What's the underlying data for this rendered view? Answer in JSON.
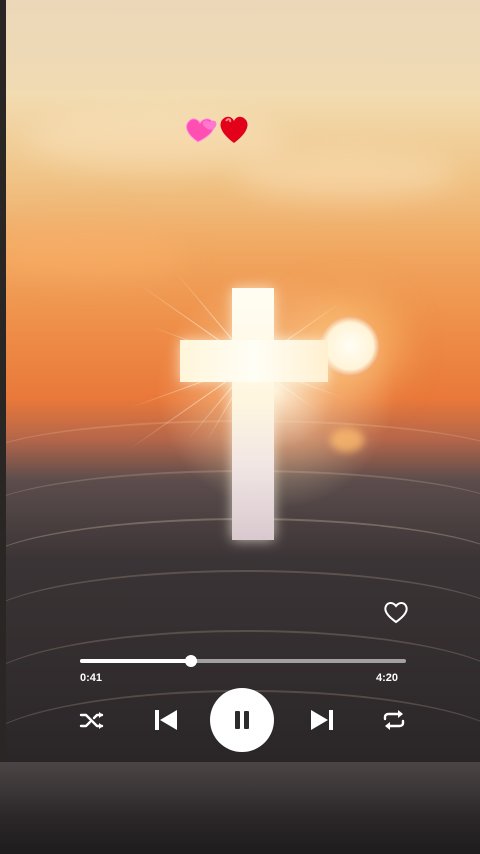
{
  "decoration": {
    "hearts_icon": "two-hearts-and-red-heart-emoji"
  },
  "player": {
    "elapsed_time": "0:41",
    "total_time": "4:20",
    "progress_fraction": 0.34,
    "is_playing": true,
    "liked": false
  },
  "icons": {
    "like": "heart-outline-icon",
    "shuffle": "shuffle-icon",
    "previous": "skip-previous-icon",
    "pause": "pause-icon",
    "next": "skip-next-icon",
    "repeat": "repeat-icon"
  },
  "colors": {
    "controls": "#ffffff",
    "pause_glyph": "#2b2b2b",
    "sky_top": "#f2ddb3",
    "sky_mid": "#ee8d47",
    "sea": "#3b3436"
  }
}
